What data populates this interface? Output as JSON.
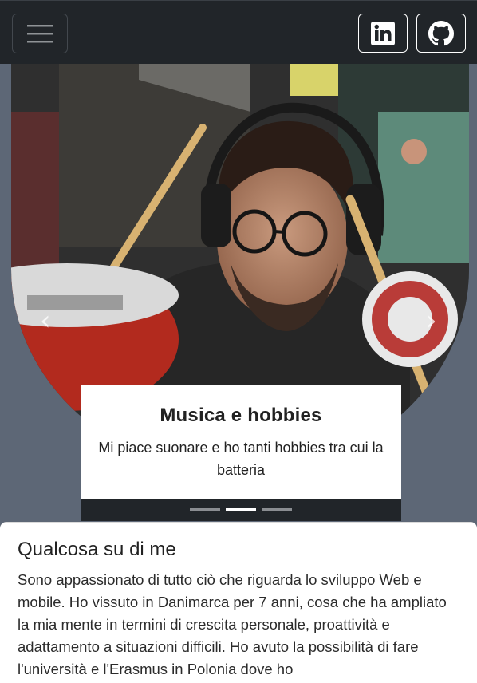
{
  "navbar": {
    "toggler_icon": "hamburger-menu-icon",
    "social": [
      {
        "icon": "linkedin-icon"
      },
      {
        "icon": "github-icon"
      }
    ]
  },
  "carousel": {
    "prev_icon": "chevron-left-icon",
    "next_icon": "chevron-right-icon",
    "caption_title": "Musica e hobbies",
    "caption_text": "Mi piace suonare e ho tanti hobbies tra cui la batteria",
    "indicators": 3,
    "active_index": 1
  },
  "about": {
    "title": "Qualcosa su di me",
    "text": "Sono appassionato di tutto ciò che riguarda lo sviluppo Web e mobile. Ho vissuto in Danimarca per 7 anni, cosa che ha ampliato la mia mente in termini di crescita personale, proattività e adattamento a situazioni difficili. Ho avuto la possibilità di fare l'università e l'Erasmus in Polonia dove ho"
  },
  "colors": {
    "navbar_bg": "#212529",
    "page_bg": "#5d6776",
    "card_bg": "#ffffff"
  }
}
